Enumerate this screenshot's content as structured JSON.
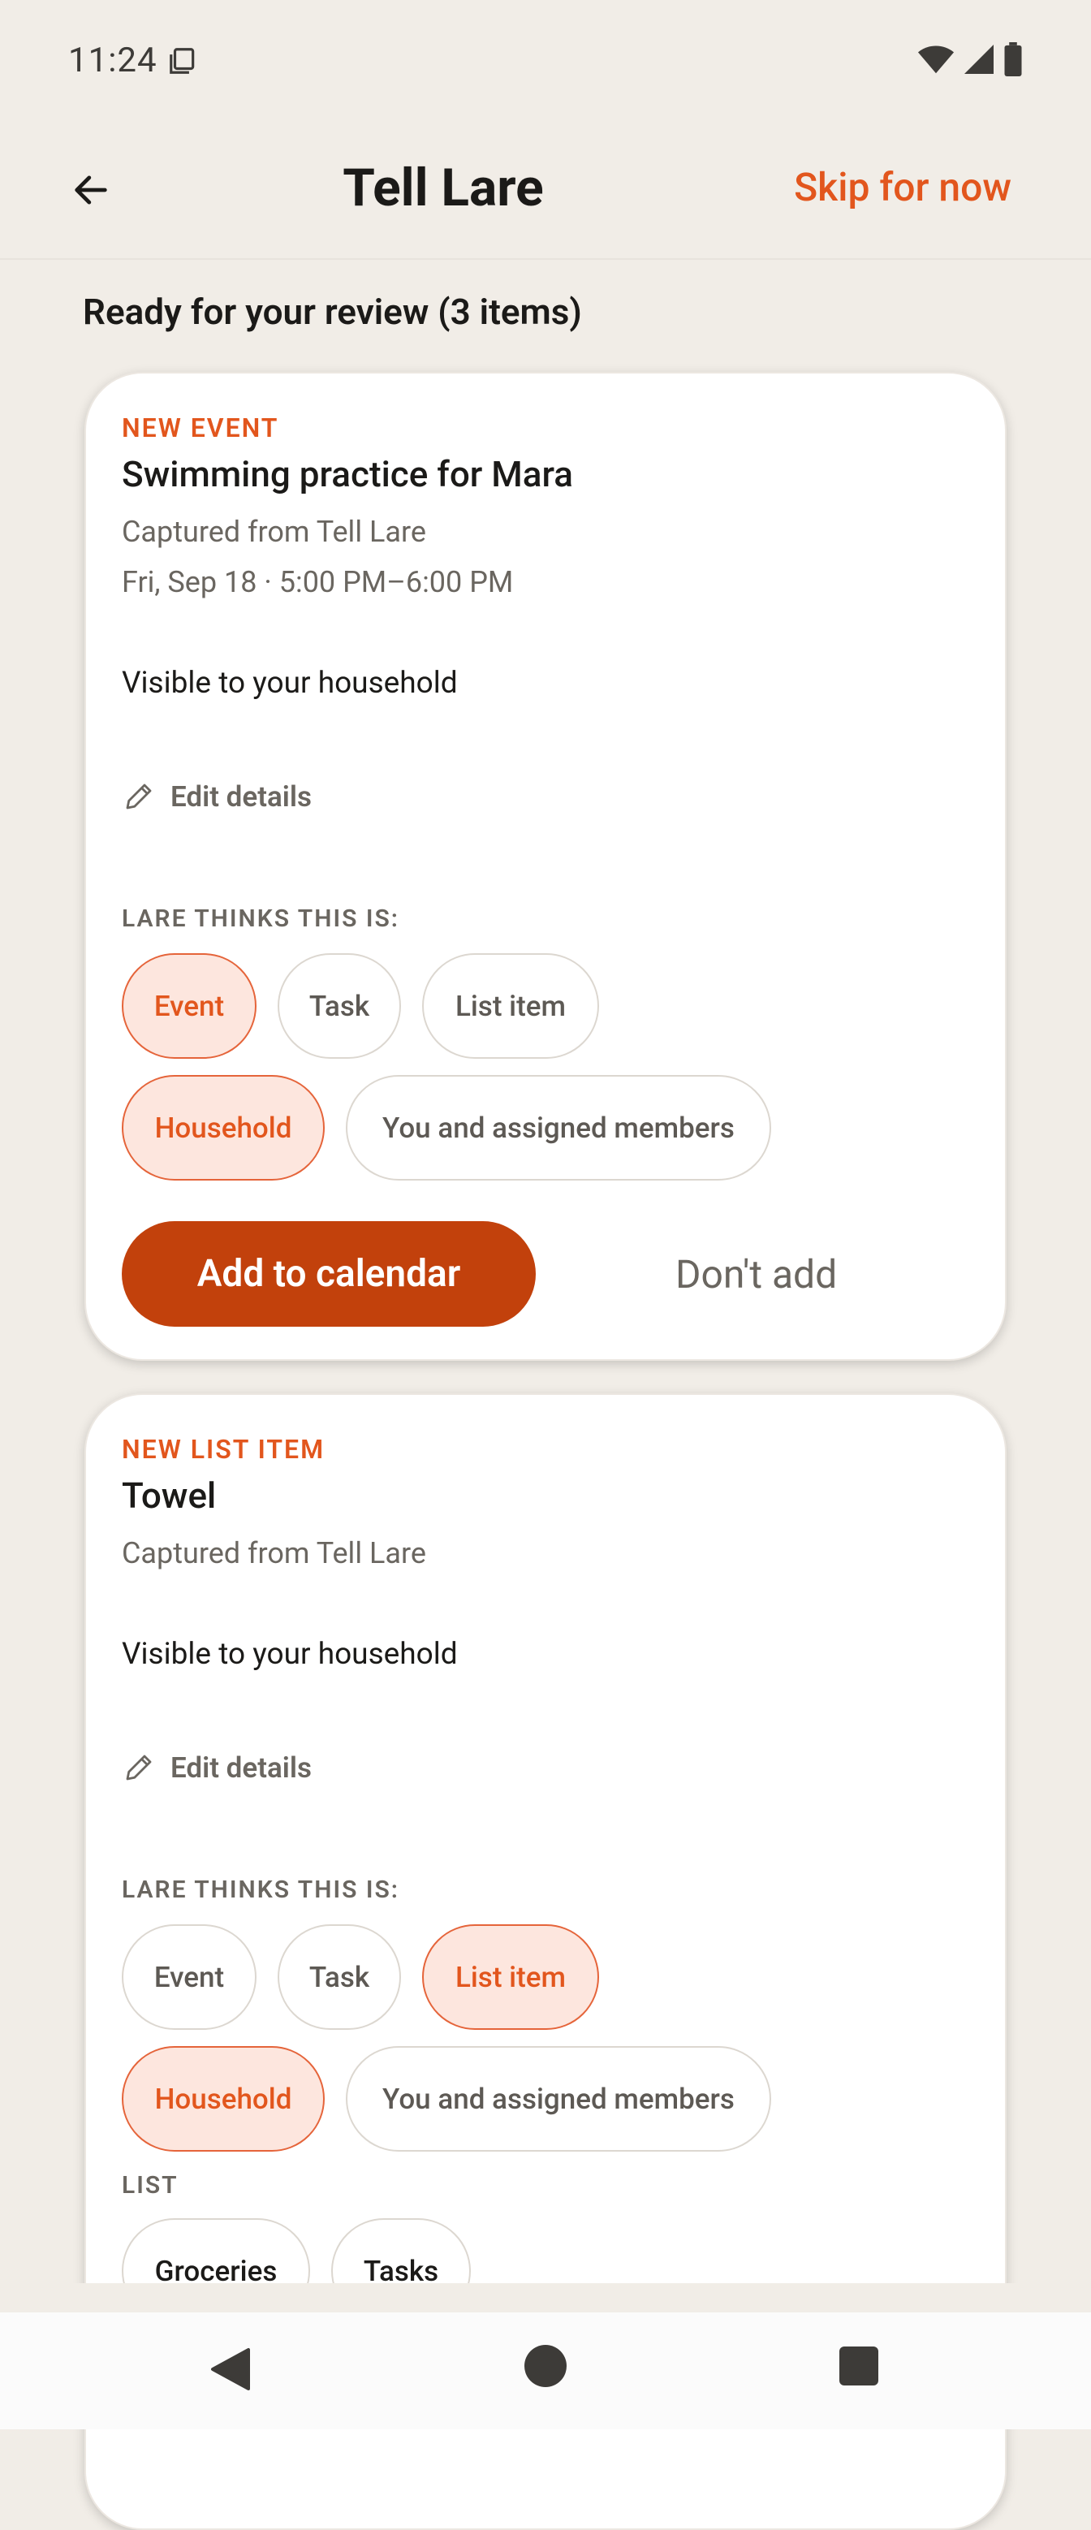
{
  "status_bar": {
    "time": "11:24"
  },
  "app_bar": {
    "title": "Tell Lare",
    "skip_label": "Skip for now"
  },
  "section_heading": "Ready for your review (3 items)",
  "cards": [
    {
      "kicker": "NEW EVENT",
      "title": "Swimming practice for Mara",
      "source": "Captured from Tell Lare",
      "when": "Fri, Sep 18 · 5:00 PM–6:00 PM",
      "visibility": "Visible to your household",
      "edit_label": "Edit details",
      "lare_label": "LARE THINKS THIS IS:",
      "type_chips": [
        {
          "label": "Event",
          "selected": true
        },
        {
          "label": "Task",
          "selected": false
        },
        {
          "label": "List item",
          "selected": false
        }
      ],
      "audience_chips": [
        {
          "label": "Household",
          "selected": true
        },
        {
          "label": "You and assigned members",
          "selected": false
        }
      ],
      "primary_action": "Add to calendar",
      "secondary_action": "Don't add"
    },
    {
      "kicker": "NEW LIST ITEM",
      "title": "Towel",
      "source": "Captured from Tell Lare",
      "visibility": "Visible to your household",
      "edit_label": "Edit details",
      "lare_label": "LARE THINKS THIS IS:",
      "type_chips": [
        {
          "label": "Event",
          "selected": false
        },
        {
          "label": "Task",
          "selected": false
        },
        {
          "label": "List item",
          "selected": true
        }
      ],
      "audience_chips": [
        {
          "label": "Household",
          "selected": true
        },
        {
          "label": "You and assigned members",
          "selected": false
        }
      ],
      "list_label": "LIST",
      "list_chips": [
        {
          "label": "Groceries"
        },
        {
          "label": "Tasks"
        }
      ]
    }
  ],
  "colors": {
    "accent": "#e2561d",
    "primary_button": "#c2410c",
    "background": "#f1ede7",
    "chip_selected_bg": "#fde6de"
  }
}
